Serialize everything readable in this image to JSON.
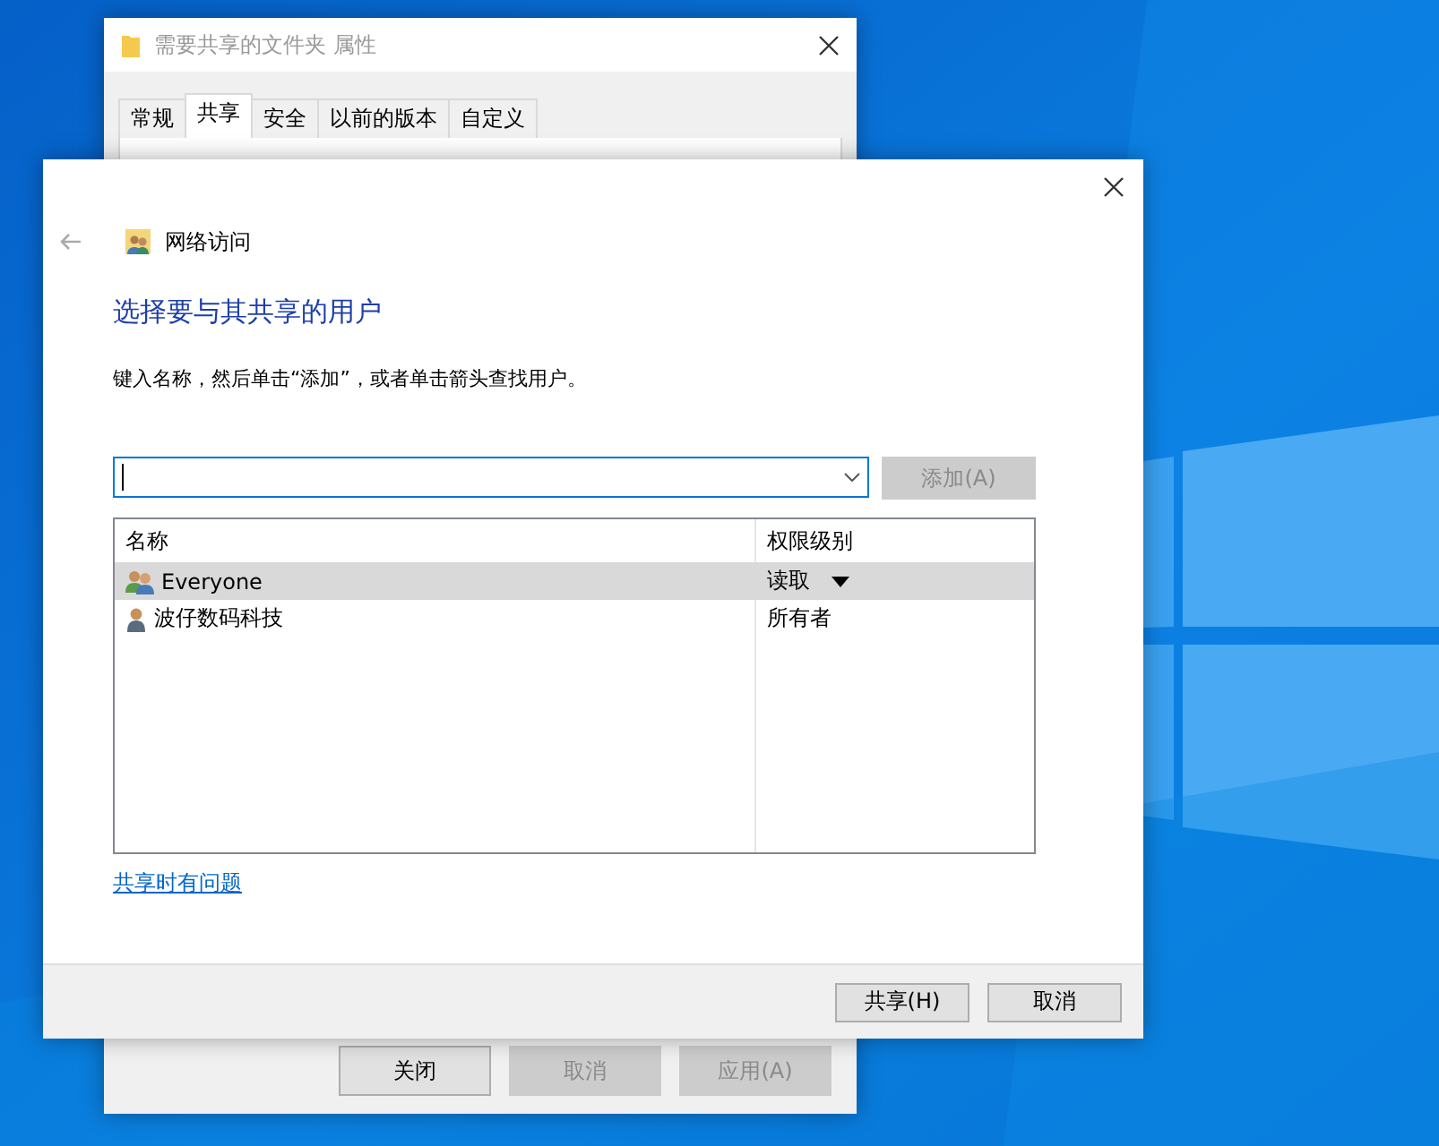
{
  "back_window": {
    "title": "需要共享的文件夹 属性",
    "tabs": [
      {
        "label": "常规",
        "selected": false
      },
      {
        "label": "共享",
        "selected": true
      },
      {
        "label": "安全",
        "selected": false
      },
      {
        "label": "以前的版本",
        "selected": false
      },
      {
        "label": "自定义",
        "selected": false
      }
    ],
    "buttons": [
      {
        "label": "关闭",
        "disabled": false
      },
      {
        "label": "取消",
        "disabled": true
      },
      {
        "label": "应用(A)",
        "disabled": true
      }
    ]
  },
  "dialog": {
    "breadcrumb": "网络访问",
    "heading": "选择要与其共享的用户",
    "instruction": "键入名称，然后单击“添加”，或者单击箭头查找用户。",
    "add_button": {
      "label": "添加(A)",
      "disabled": true
    },
    "table": {
      "columns": [
        "名称",
        "权限级别"
      ],
      "rows": [
        {
          "kind": "group",
          "name": "Everyone",
          "permission": "读取",
          "selected": true
        },
        {
          "kind": "user",
          "name": "波仔数码科技",
          "permission": "所有者",
          "selected": false
        }
      ]
    },
    "help_link": "共享时有问题",
    "buttons": [
      {
        "label": "共享(H)",
        "disabled": false
      },
      {
        "label": "取消",
        "disabled": false
      }
    ]
  }
}
